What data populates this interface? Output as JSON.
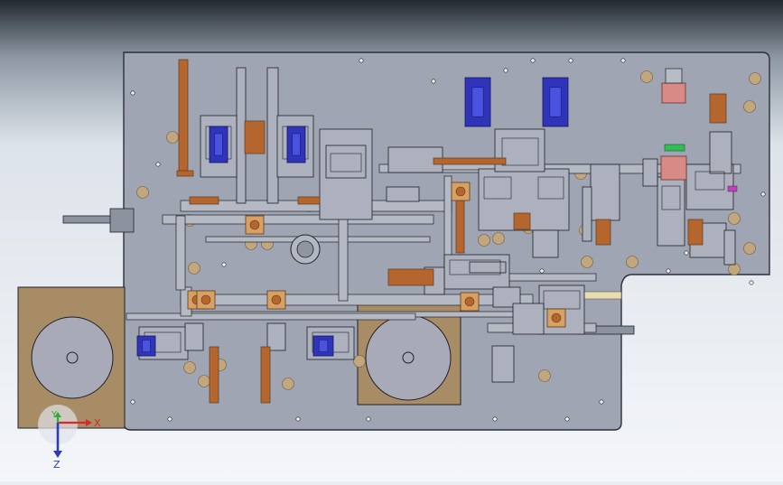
{
  "scene": {
    "kind": "cad-top-view",
    "colors": {
      "bg_top": "#252b33",
      "bg_bottom": "#f2f5f8",
      "plate": "#9fa5b2",
      "plate_edge": "#2b2f38",
      "line": "#1e2129",
      "copper": "#b5652e",
      "copper_light": "#d9a064",
      "reel": "#a8aab8",
      "tray": "#a88c66",
      "blue": "#2f34b8",
      "pink": "#d88a86",
      "green": "#2fbf55",
      "magenta": "#c040c0",
      "hole": "#c2a67d",
      "steel": "#8d939e"
    }
  },
  "triad": {
    "x_label": "X",
    "y_label": "Y",
    "z_label": "Z",
    "x_color": "#d8282a",
    "y_color": "#2fae3a",
    "z_color": "#2a3cbe"
  }
}
